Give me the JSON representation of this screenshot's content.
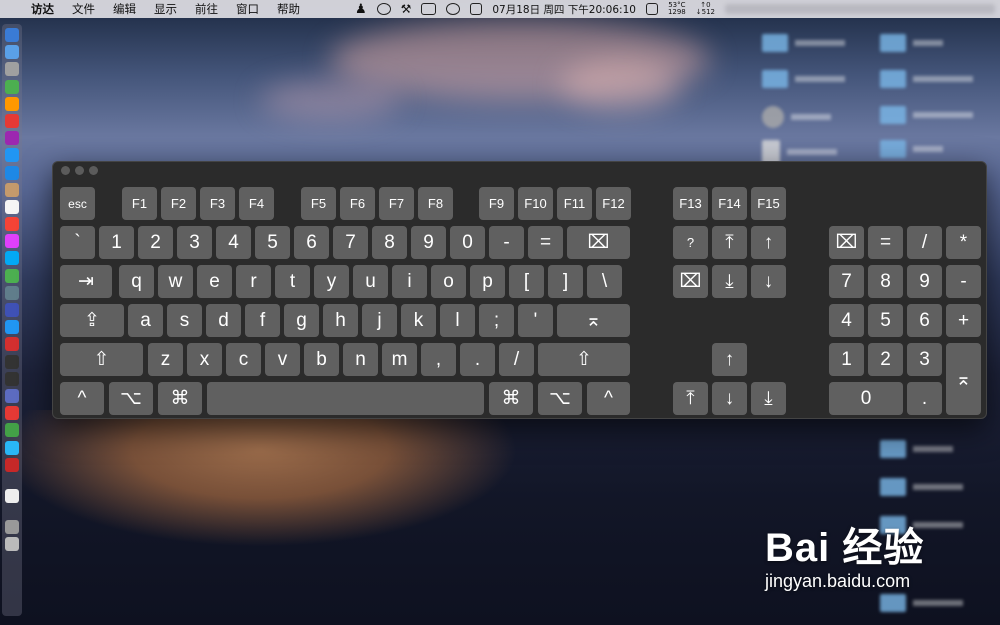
{
  "menubar": {
    "app_name": "访达",
    "menus": [
      "文件",
      "编辑",
      "显示",
      "前往",
      "窗口",
      "帮助"
    ],
    "datetime": "07月18日 周四 下午20:06:10",
    "temp": "53°C",
    "fan": "1298",
    "net_up": "↑0",
    "net_down": "↓512"
  },
  "keyboard": {
    "row_fn": {
      "esc": "esc",
      "f": [
        "F1",
        "F2",
        "F3",
        "F4",
        "F5",
        "F6",
        "F7",
        "F8",
        "F9",
        "F10",
        "F11",
        "F12",
        "F13",
        "F14",
        "F15"
      ]
    },
    "row_num": [
      "`",
      "1",
      "2",
      "3",
      "4",
      "5",
      "6",
      "7",
      "8",
      "9",
      "0",
      "-",
      "="
    ],
    "row_q": [
      "q",
      "w",
      "e",
      "r",
      "t",
      "y",
      "u",
      "i",
      "o",
      "p",
      "[",
      "]",
      "\\"
    ],
    "row_a": [
      "a",
      "s",
      "d",
      "f",
      "g",
      "h",
      "j",
      "k",
      "l",
      ";",
      "'"
    ],
    "row_z": [
      "z",
      "x",
      "c",
      "v",
      "b",
      "n",
      "m",
      ",",
      ".",
      "/"
    ],
    "symbols": {
      "tab": "⇥",
      "caps": "⇪",
      "shift": "⇧",
      "ctrl": "^",
      "opt": "⌥",
      "cmd": "⌘",
      "help": "?",
      "top": "⤒",
      "up": "↑",
      "down": "↓",
      "bottom": "⤓",
      "clear": "⌧",
      "enter": "⌅"
    },
    "numpad": [
      "=",
      "/",
      "*",
      "7",
      "8",
      "9",
      "-",
      "4",
      "5",
      "6",
      "+",
      "1",
      "2",
      "3",
      "0",
      "."
    ]
  },
  "watermark": {
    "logo": "Bai 经验",
    "url": "jingyan.baidu.com"
  },
  "colors": {
    "key": "#606060",
    "window": "#2b2b2b",
    "menubar": "#d7d7de"
  }
}
